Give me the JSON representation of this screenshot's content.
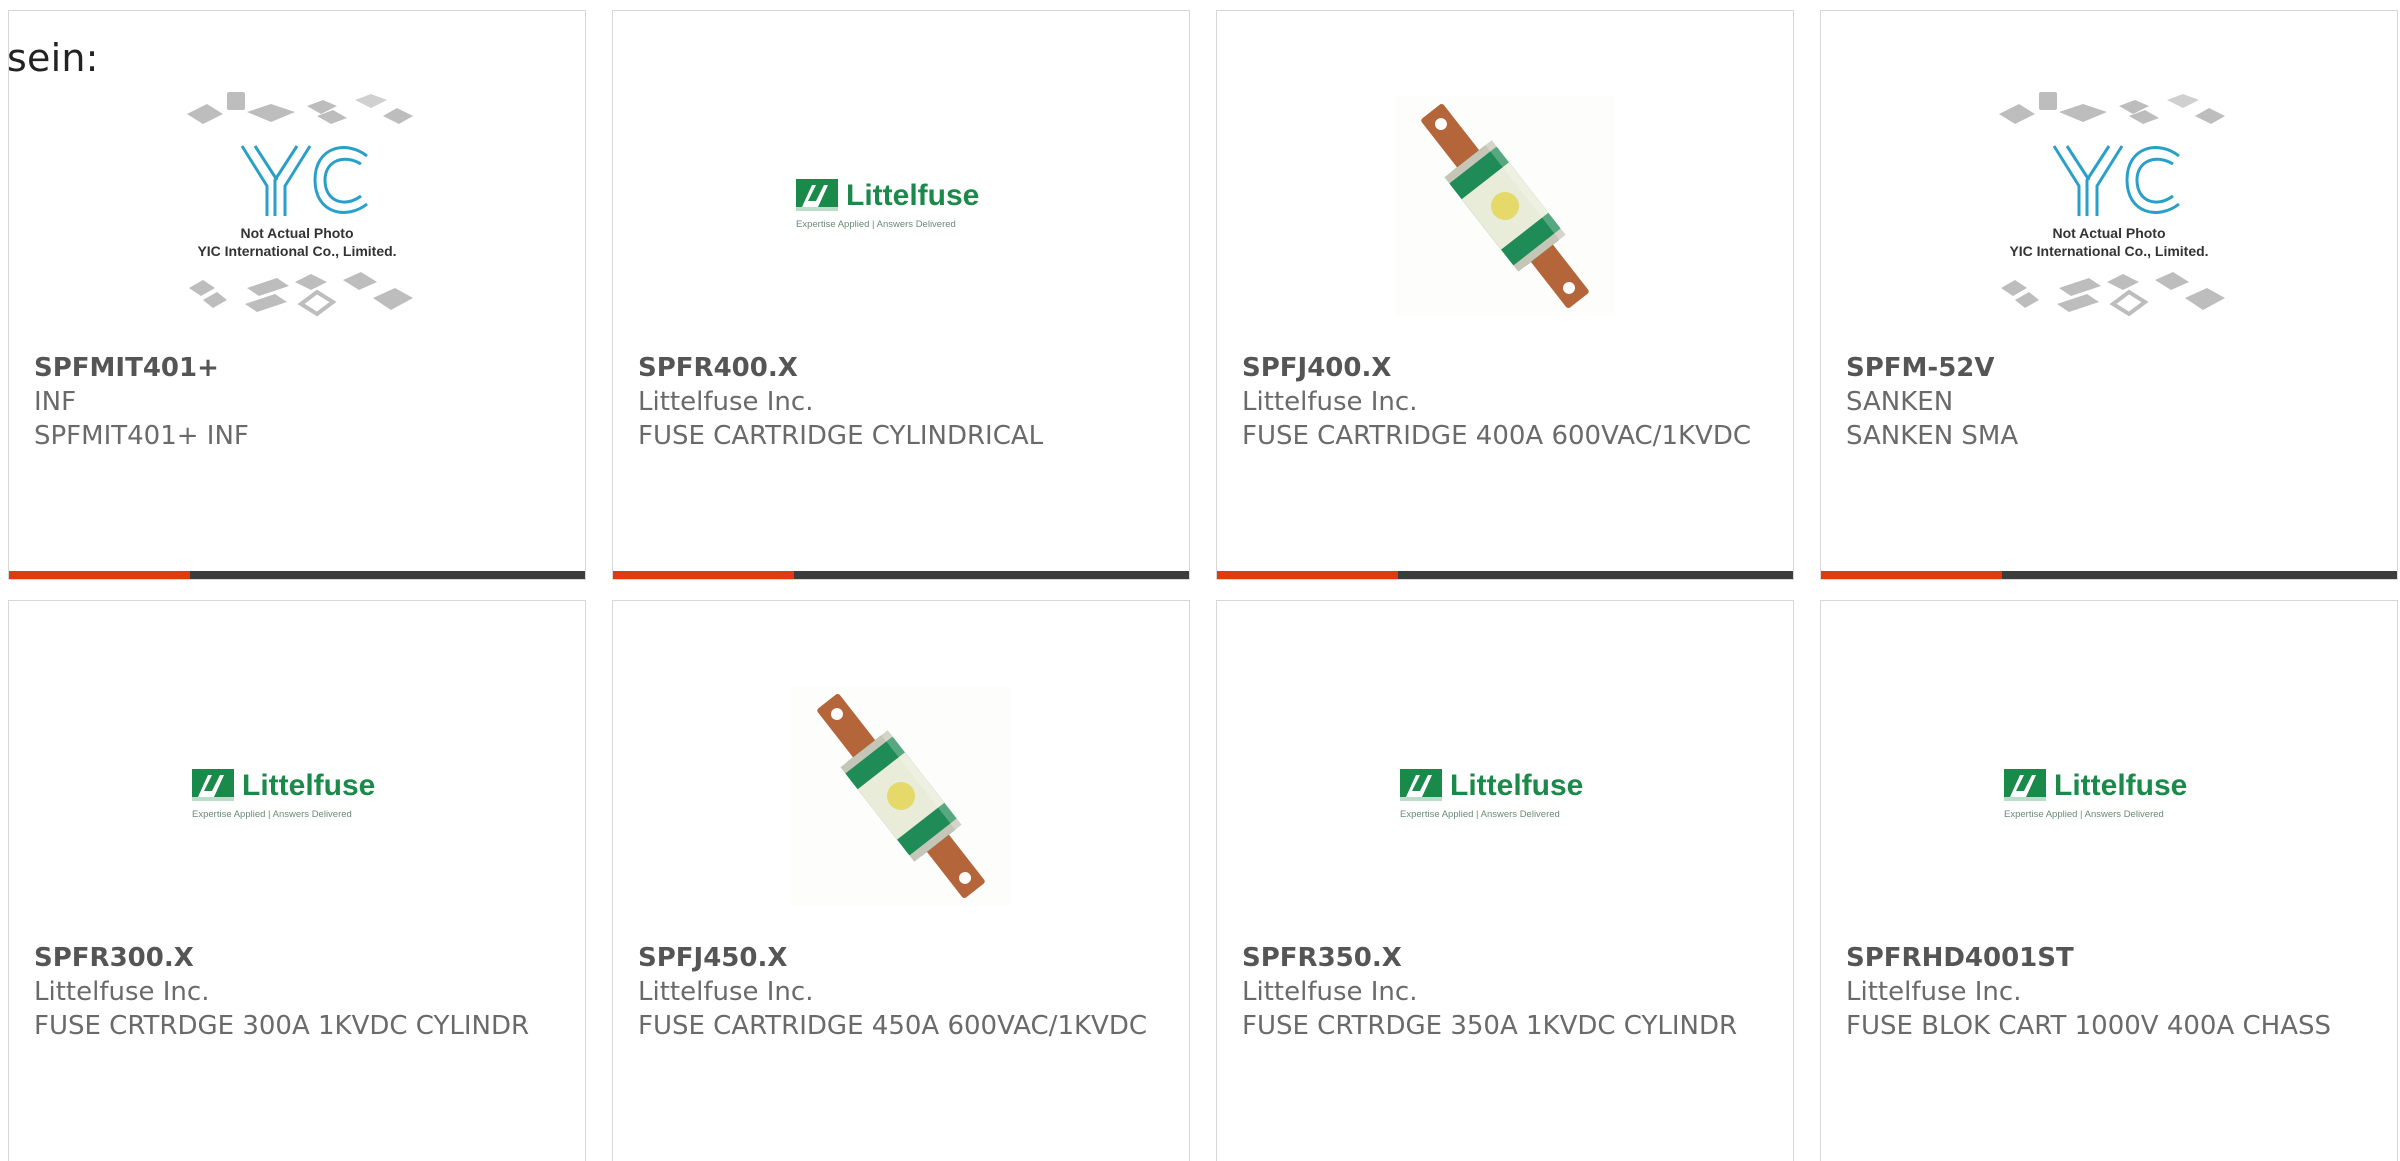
{
  "page": {
    "intro_text": "sein:"
  },
  "colors": {
    "accent_orange": "#e03a10",
    "bar_dark": "#3c3c3c",
    "littelfuse_green": "#1a8a4a"
  },
  "logos": {
    "littelfuse_name": "Littelfuse",
    "littelfuse_tagline": "Expertise Applied | Answers Delivered",
    "yic_name": "YIC",
    "yic_note": "Not Actual Photo",
    "yic_company": "YIC International Co., Limited."
  },
  "products": [
    {
      "part_number": "SPFMIT401+",
      "manufacturer": "INF",
      "description": "SPFMIT401+ INF",
      "image_type": "yic-placeholder",
      "has_accent_bar": true
    },
    {
      "part_number": "SPFR400.X",
      "manufacturer": "Littelfuse Inc.",
      "description": "FUSE CARTRIDGE CYLINDRICAL",
      "image_type": "littelfuse-logo",
      "has_accent_bar": true
    },
    {
      "part_number": "SPFJ400.X",
      "manufacturer": "Littelfuse Inc.",
      "description": "FUSE CARTRIDGE 400A 600VAC/1KVDC",
      "image_type": "fuse-photo",
      "has_accent_bar": true
    },
    {
      "part_number": "SPFM-52V",
      "manufacturer": "SANKEN",
      "description": "SANKEN SMA",
      "image_type": "yic-placeholder",
      "has_accent_bar": true
    },
    {
      "part_number": "SPFR300.X",
      "manufacturer": "Littelfuse Inc.",
      "description": "FUSE CRTRDGE 300A 1KVDC CYLINDR",
      "image_type": "littelfuse-logo",
      "has_accent_bar": false
    },
    {
      "part_number": "SPFJ450.X",
      "manufacturer": "Littelfuse Inc.",
      "description": "FUSE CARTRIDGE 450A 600VAC/1KVDC",
      "image_type": "fuse-photo",
      "has_accent_bar": false
    },
    {
      "part_number": "SPFR350.X",
      "manufacturer": "Littelfuse Inc.",
      "description": "FUSE CRTRDGE 350A 1KVDC CYLINDR",
      "image_type": "littelfuse-logo",
      "has_accent_bar": false
    },
    {
      "part_number": "SPFRHD4001ST",
      "manufacturer": "Littelfuse Inc.",
      "description": "FUSE BLOK CART 1000V 400A CHASS",
      "image_type": "littelfuse-logo",
      "has_accent_bar": false
    }
  ]
}
